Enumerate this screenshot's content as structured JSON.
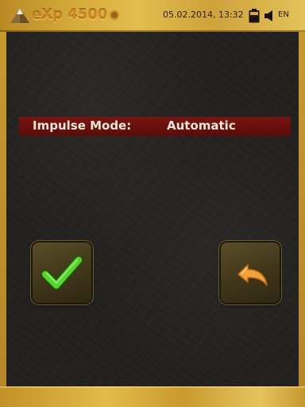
{
  "header": {
    "logo_text": "eXp 4500",
    "datetime": "05.02.2014, 13:32",
    "language": "EN",
    "icons": {
      "logo": "pyramid-icon",
      "battery": "battery-icon",
      "speaker": "speaker-icon"
    }
  },
  "setting": {
    "label": "Impulse Mode:",
    "value": "Automatic"
  },
  "buttons": {
    "confirm": "checkmark-icon",
    "back": "undo-arrow-icon"
  },
  "colors": {
    "gold": "#d6ab3a",
    "row_red": "#7a1410",
    "check_green": "#4fd12b",
    "arrow_orange": "#f5a23a",
    "background": "#242220"
  }
}
